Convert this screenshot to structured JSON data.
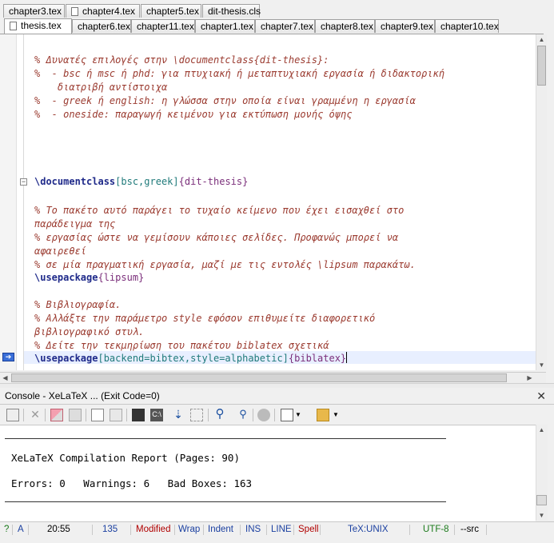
{
  "tabs_row1": [
    {
      "label": "chapter3.tex",
      "icon": false
    },
    {
      "label": "chapter4.tex",
      "icon": true
    },
    {
      "label": "chapter5.tex",
      "icon": false
    },
    {
      "label": "dit-thesis.cls",
      "icon": false
    }
  ],
  "tabs_row2": [
    {
      "label": "thesis.tex",
      "icon": true,
      "active": true
    },
    {
      "label": "chapter6.tex"
    },
    {
      "label": "chapter11.tex"
    },
    {
      "label": "chapter1.tex"
    },
    {
      "label": "chapter7.tex"
    },
    {
      "label": "chapter8.tex"
    },
    {
      "label": "chapter9.tex"
    },
    {
      "label": "chapter10.tex"
    }
  ],
  "editor": {
    "comment1": "% Δυνατές επιλογές στην \\documentclass{dit-thesis}:",
    "comment2": "%  - bsc ή msc ή phd: για πτυχιακή ή μεταπτυχιακή εργασία ή διδακτορική",
    "comment3": "    διατριβή αντίστοιχα",
    "comment4": "%  - greek ή english: η γλώσσα στην οποία είναι γραμμένη η εργασία",
    "comment5": "%  - oneside: παραγωγή κειμένου για εκτύπωση μονής όψης",
    "docclass_cmd": "\\documentclass",
    "docclass_opt": "[bsc,greek]",
    "docclass_arg": "{dit-thesis}",
    "comment6": "% Το πακέτο αυτό παράγει το τυχαίο κείμενο που έχει εισαχθεί στο",
    "comment7": "παράδειγμα της",
    "comment8": "% εργασίας ώστε να γεμίσουν κάποιες σελίδες. Προφανώς μπορεί να",
    "comment9": "αφαιρεθεί",
    "comment10": "% σε μία πραγματική εργασία, μαζί με τις εντολές \\lipsum παρακάτω.",
    "usepkg1_cmd": "\\usepackage",
    "usepkg1_arg": "{lipsum}",
    "comment11": "% Βιβλιογραφία.",
    "comment12": "% Αλλάξτε την παράμετρο style εφόσον επιθυμείτε διαφορετικό",
    "comment13": "βιβλιογραφικό στυλ.",
    "comment14": "% Δείτε την τεκμηρίωση του πακέτου biblatex σχετικά",
    "usepkg2_cmd": "\\usepackage",
    "usepkg2_opt": "[backend=bibtex,style=alphabetic]",
    "usepkg2_arg": "{biblatex}"
  },
  "console": {
    "title": "Console - XeLaTeX ... (Exit Code=0)",
    "report_title": "XeLaTeX Compilation Report (Pages: 90)",
    "report_stats": "Errors: 0   Warnings: 6   Bad Boxes: 163"
  },
  "status": {
    "help": "?",
    "mode": "A",
    "position": "20:55",
    "chars": "135",
    "modified": "Modified",
    "wrap": "Wrap",
    "indent": "Indent",
    "ins": "INS",
    "line": "LINE",
    "spell": "Spell",
    "format": "TeX:UNIX",
    "encoding": "UTF-8",
    "src": "--src"
  },
  "colors": {
    "comment": "#9b3b30",
    "keyword": "#1f2a8a",
    "option": "#1f7a7a",
    "argument": "#7b2f7b",
    "modified": "#b00000",
    "status_blue": "#1a3fa0"
  }
}
